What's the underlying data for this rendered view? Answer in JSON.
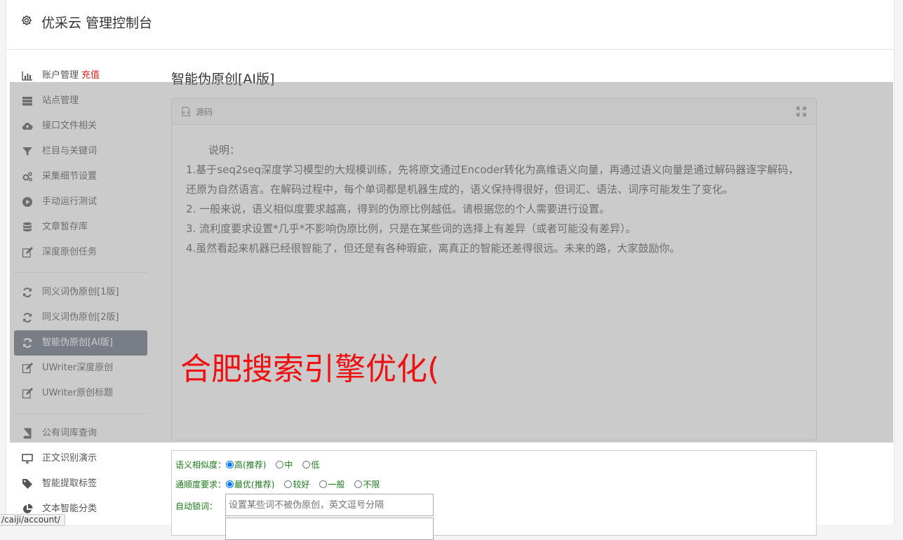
{
  "app": {
    "title": "优采云 管理控制台"
  },
  "sidebar": {
    "group1": [
      {
        "label": "账户管理",
        "icon": "bar-chart-icon",
        "badge": "充值"
      },
      {
        "label": "站点管理",
        "icon": "server-icon"
      },
      {
        "label": "接口文件相关",
        "icon": "cloud-upload-icon"
      },
      {
        "label": "栏目与关键词",
        "icon": "filter-icon"
      },
      {
        "label": "采集细节设置",
        "icon": "cogs-icon"
      },
      {
        "label": "手动运行测试",
        "icon": "play-circle-icon"
      },
      {
        "label": "文章暂存库",
        "icon": "database-icon"
      },
      {
        "label": "深度原创任务",
        "icon": "edit-icon"
      }
    ],
    "group2": [
      {
        "label": "同义词伪原创[1版]",
        "icon": "refresh-icon"
      },
      {
        "label": "同义词伪原创[2版]",
        "icon": "refresh-icon"
      },
      {
        "label": "智能伪原创[AI版]",
        "icon": "refresh-icon",
        "active": true
      },
      {
        "label": "UWriter深度原创",
        "icon": "edit-icon"
      },
      {
        "label": "UWriter原创标题",
        "icon": "edit-icon"
      }
    ],
    "group3": [
      {
        "label": "公有词库查询",
        "icon": "book-icon"
      },
      {
        "label": "正文识别演示",
        "icon": "monitor-icon"
      },
      {
        "label": "智能提取标签",
        "icon": "tag-icon"
      },
      {
        "label": "文本智能分类",
        "icon": "pie-chart-icon"
      }
    ]
  },
  "main": {
    "title": "智能伪原创[AI版]",
    "panel": {
      "header": "源码",
      "intro": "说明：",
      "lines": [
        "1.基于seq2seq深度学习模型的大规模训练，先将原文通过Encoder转化为高维语义向量，再通过语义向量是通过解码器逐字解码，还原为自然语言。在解码过程中，每个单词都是机器生成的，语义保持得很好，但词汇、语法、词序可能发生了变化。",
        "2. 一般来说，语义相似度要求越高，得到的伪原比例越低。请根据您的个人需要进行设置。",
        "3. 流利度要求设置*几乎*不影响伪原比例，只是在某些词的选择上有差异（或者可能没有差异）。",
        "4.虽然看起来机器已经很智能了，但还是有各种瑕疵，离真正的智能还差得很远。未来的路，大家鼓励你。"
      ]
    },
    "watermark": "合肥搜索引擎优化(",
    "form": {
      "similarity": {
        "label": "语义相似度：",
        "options": [
          "高(推荐)",
          "中",
          "低"
        ],
        "selected": "高(推荐)"
      },
      "fluency": {
        "label": "通顺度要求：",
        "options": [
          "最优(推荐)",
          "较好",
          "一般",
          "不限"
        ],
        "selected": "最优(推荐)"
      },
      "lock": {
        "label": "自动锁词：",
        "placeholder": "设置某些词不被伪原创，英文逗号分隔"
      }
    }
  },
  "status_url": "/caiji/account/"
}
